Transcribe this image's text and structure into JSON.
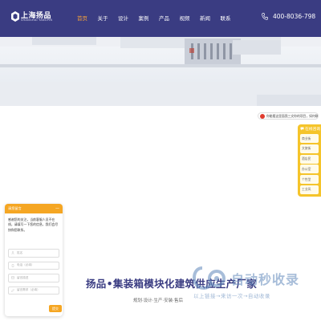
{
  "header": {
    "logo_name": "上海扬品",
    "logo_sub": "SHANGHAI YANGPIN",
    "nav": [
      {
        "label": "首页",
        "active": true
      },
      {
        "label": "关于",
        "active": false
      },
      {
        "label": "设计",
        "active": false
      },
      {
        "label": "案例",
        "active": false
      },
      {
        "label": "产品",
        "active": false
      },
      {
        "label": "视频",
        "active": false
      },
      {
        "label": "新闻",
        "active": false
      },
      {
        "label": "联系",
        "active": false
      }
    ],
    "phone": "400-8036-798",
    "phone_icon": "phone-icon",
    "colors": {
      "bg": "#3a3c82",
      "active": "#f4a03a"
    }
  },
  "tooltip": {
    "text": "你能看这里面我三文你的项目，如何联系？",
    "icon": "notification-icon"
  },
  "side_float": {
    "title": "在线咨询",
    "items": [
      "商业街",
      "文旅街",
      "酒店民",
      "办公室",
      "个性型",
      "工业风"
    ]
  },
  "chat": {
    "title": "请您留言",
    "close": "—",
    "message": "感谢您的关注，当前客服人员不在线，请填写一下您的信息，我们会尽快和您联系。",
    "fields": [
      {
        "placeholder": "姓名",
        "icon": "user-icon"
      },
      {
        "placeholder": "电话（必填）",
        "icon": "phone-icon"
      },
      {
        "placeholder": "留言描述",
        "icon": "email-icon"
      },
      {
        "placeholder": "留言需求（必填）",
        "icon": "edit-icon"
      }
    ],
    "submit": "提交",
    "accent": "#f5a623"
  },
  "headline": {
    "title": "扬品•集装箱模块化建筑供应生产厂家",
    "subtitle": "规划·设计·生产·安装·售后"
  },
  "watermark": {
    "text": "自动秒收录",
    "sub": "以上链接→来访一次→自动收录"
  }
}
